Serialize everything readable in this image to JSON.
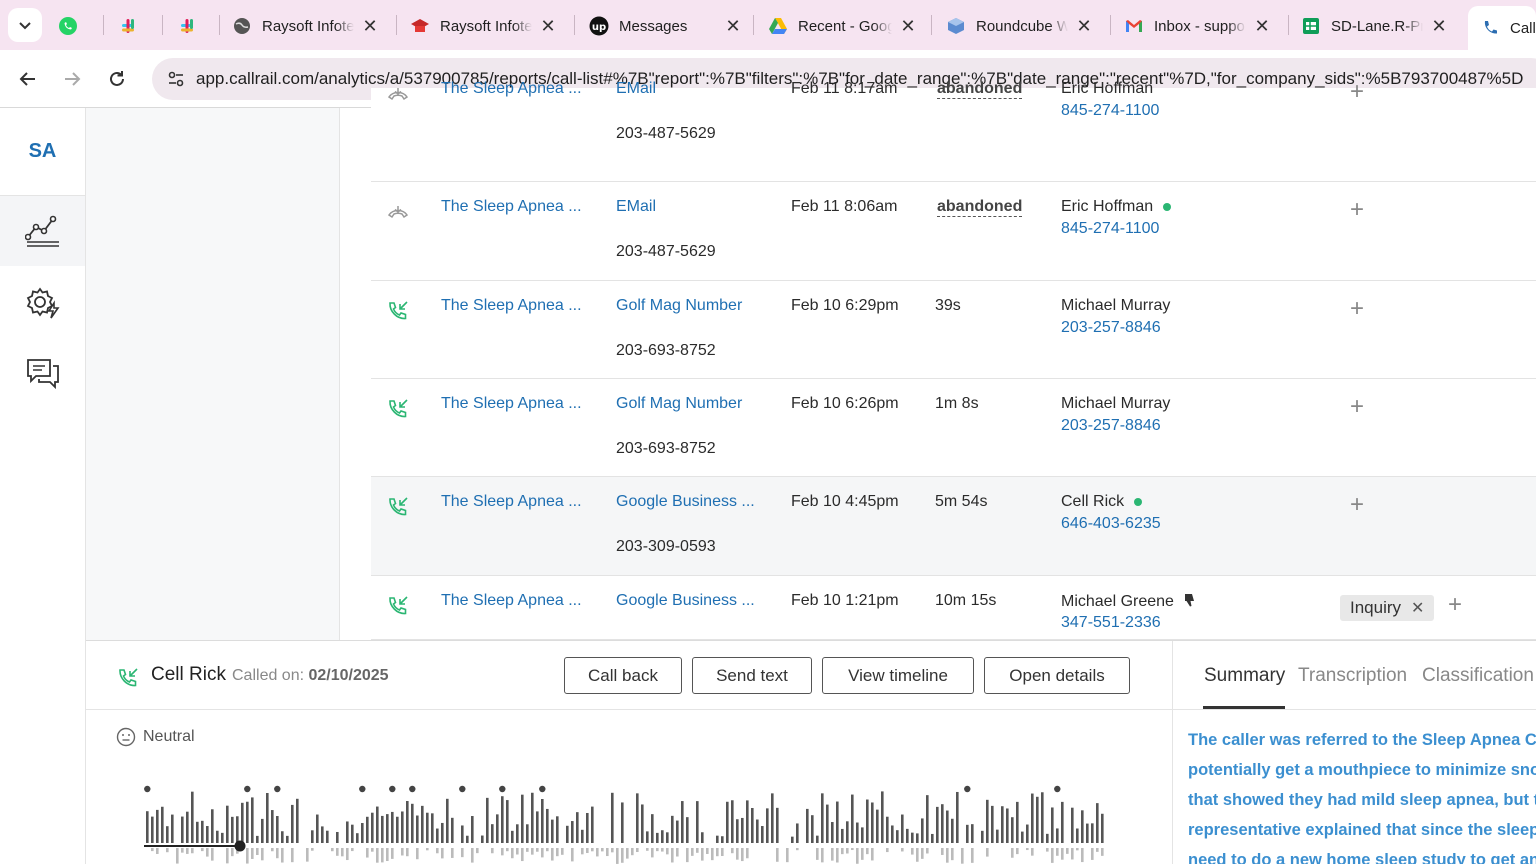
{
  "browser": {
    "tabs": [
      {
        "label": "",
        "icon": "whatsapp-icon",
        "color": "#25d366"
      },
      {
        "label": "",
        "icon": "slack-icon",
        "color": "#e01e5a"
      },
      {
        "label": "",
        "icon": "slack-icon",
        "color": "#e01e5a"
      },
      {
        "label": "Raysoft Infotech",
        "icon": "globe-icon"
      },
      {
        "label": "Raysoft Infotech",
        "icon": "school-icon"
      },
      {
        "label": "Messages",
        "icon": "upwork-icon"
      },
      {
        "label": "Recent - Google Drive",
        "icon": "drive-icon"
      },
      {
        "label": "Roundcube Webmail",
        "icon": "roundcube-icon"
      },
      {
        "label": "Inbox - support",
        "icon": "gmail-icon"
      },
      {
        "label": "SD-Lane.R-Prod",
        "icon": "sheets-icon"
      },
      {
        "label": "Call",
        "icon": "callrail-icon"
      }
    ],
    "url": "app.callrail.com/analytics/a/537900785/reports/call-list#%7B\"report\":%7B\"filters\":%7B\"for_date_range\":%7B\"date_range\":\"recent\"%7D,\"for_company_sids\":%5B793700487%5D"
  },
  "sidebar": {
    "logo": "SA",
    "items": [
      {
        "name": "reports",
        "icon": "analytics-chart-icon"
      },
      {
        "name": "settings",
        "icon": "settings-automation-icon"
      },
      {
        "name": "conversations",
        "icon": "chat-bubbles-icon"
      }
    ]
  },
  "calls": [
    {
      "company": "The Sleep Apnea ...",
      "source": "EMail",
      "number": "203-487-5629",
      "date": "Feb 11 8:17am",
      "duration": "abandoned",
      "caller": "Eric Hoffman",
      "caller_phone": "845-274-1100",
      "dot": false,
      "icon": "missed-call-icon"
    },
    {
      "company": "The Sleep Apnea ...",
      "source": "EMail",
      "number": "203-487-5629",
      "date": "Feb 11 8:06am",
      "duration": "abandoned",
      "caller": "Eric Hoffman",
      "caller_phone": "845-274-1100",
      "dot": true,
      "icon": "missed-call-icon"
    },
    {
      "company": "The Sleep Apnea ...",
      "source": "Golf Mag Number",
      "number": "203-693-8752",
      "date": "Feb 10 6:29pm",
      "duration": "39s",
      "caller": "Michael Murray",
      "caller_phone": "203-257-8846",
      "dot": false,
      "icon": "inbound-call-icon"
    },
    {
      "company": "The Sleep Apnea ...",
      "source": "Golf Mag Number",
      "number": "203-693-8752",
      "date": "Feb 10 6:26pm",
      "duration": "1m 8s",
      "caller": "Michael Murray",
      "caller_phone": "203-257-8846",
      "dot": false,
      "icon": "inbound-call-icon"
    },
    {
      "company": "The Sleep Apnea ...",
      "source": "Google Business ...",
      "number": "203-309-0593",
      "date": "Feb 10 4:45pm",
      "duration": "5m 54s",
      "caller": "Cell Rick",
      "caller_phone": "646-403-6235",
      "dot": true,
      "icon": "inbound-call-icon"
    },
    {
      "company": "The Sleep Apnea ...",
      "source": "Google Business ...",
      "number": "",
      "date": "Feb 10 1:21pm",
      "duration": "10m 15s",
      "caller": "Michael Greene",
      "caller_phone": "347-551-2336",
      "dot": false,
      "thumb": true,
      "tag": "Inquiry",
      "icon": "inbound-call-icon"
    }
  ],
  "detail": {
    "caller": "Cell Rick",
    "called_label": "Called on:",
    "called_date": "02/10/2025",
    "buttons": {
      "call_back": "Call back",
      "send_text": "Send text",
      "view_timeline": "View timeline",
      "open_details": "Open details"
    },
    "sentiment": "Neutral",
    "tabs": {
      "summary": "Summary",
      "transcription": "Transcription",
      "classification": "Classification"
    },
    "summary_lines": [
      "The caller was referred to the Sleep Apnea Cent",
      "potentially get a mouthpiece to minimize snori",
      "that showed they had mild sleep apnea, but th",
      "representative explained that since the sleep st",
      "need to do a new home sleep study to get an u"
    ]
  },
  "colors": {
    "link": "#1f6fb2",
    "green": "#2bb673",
    "summary": "#3b8fd0",
    "tabbar": "#f6e4f1"
  }
}
